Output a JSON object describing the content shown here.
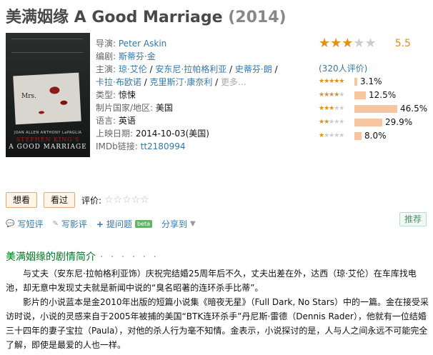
{
  "title": {
    "cn": "美满姻缘 A Good Marriage",
    "year": "(2014)"
  },
  "poster": {
    "mrs": "Mrs.",
    "actors": "JOAN ALLEN  ANTHONY LaPAGLIA",
    "stephen_king": "STEPHEN KING'S",
    "name": "A GOOD MARRIAGE"
  },
  "info": {
    "director_label": "导演:",
    "director": "Peter Askin",
    "writer_label": "编剧:",
    "writer": "斯蒂芬·金",
    "cast_label": "主演:",
    "cast": [
      "琼·艾伦",
      "安东尼·拉帕格利亚",
      "史蒂芬·朗",
      "卡拉·布欧诺",
      "克里斯汀·康奈利"
    ],
    "cast_more": "更多...",
    "genre_label": "类型:",
    "genre": "惊悚",
    "country_label": "制片国家/地区:",
    "country": "美国",
    "language_label": "语言:",
    "language": "英语",
    "release_label": "上映日期:",
    "release": "2014-10-03(美国)",
    "imdb_label": "IMDb链接:",
    "imdb": "tt2180994"
  },
  "rating": {
    "score": "5.5",
    "stars_filled": 3,
    "count": "(320人评价)",
    "breakdown": [
      {
        "stars": 5,
        "pct_value": 3.1,
        "pct": "3.1%"
      },
      {
        "stars": 4,
        "pct_value": 12.5,
        "pct": "12.5%"
      },
      {
        "stars": 3,
        "pct_value": 46.5,
        "pct": "46.5%"
      },
      {
        "stars": 2,
        "pct_value": 29.9,
        "pct": "29.9%"
      },
      {
        "stars": 1,
        "pct_value": 8.0,
        "pct": "8.0%"
      }
    ]
  },
  "actions": {
    "want": "想看",
    "seen": "看过",
    "rate_label": "评价:"
  },
  "ops": {
    "short_review": "写短评",
    "review": "写影评",
    "question": "提问题",
    "beta": "beta",
    "share": "分享到",
    "recommend": "推荐"
  },
  "summary": {
    "heading": "美满姻缘的剧情简介",
    "dots": "· · · · · ·",
    "p1": "与丈夫（安东尼·拉帕格利亚饰）庆祝完结婚25周年后不久，丈夫出差在外，达西（琼·艾伦）在车库找电池，却无意中发现丈夫就是新闻中说的“臭名昭著的连环杀手比蒂”。",
    "p2": "影片的小说蓝本是金2010年出版的短篇小说集《暗夜无星》（Full Dark, No Stars）中的一篇。金在接受采访时说，小说的灵感来自于2005年被捕的美国“BTK连环杀手”丹尼斯·雷德（Dennis Rader），他就有一位结婚三十四年的妻子宝拉（Paula），对他的杀人行为毫不知情。金表示，小说探讨的是，人与人之间永远不可能完全了解，即使是最爱的人也一样。"
  },
  "colors": {
    "star": "#e09015",
    "link": "#3377aa",
    "green": "#007722",
    "bar": "#f7c5a0"
  }
}
